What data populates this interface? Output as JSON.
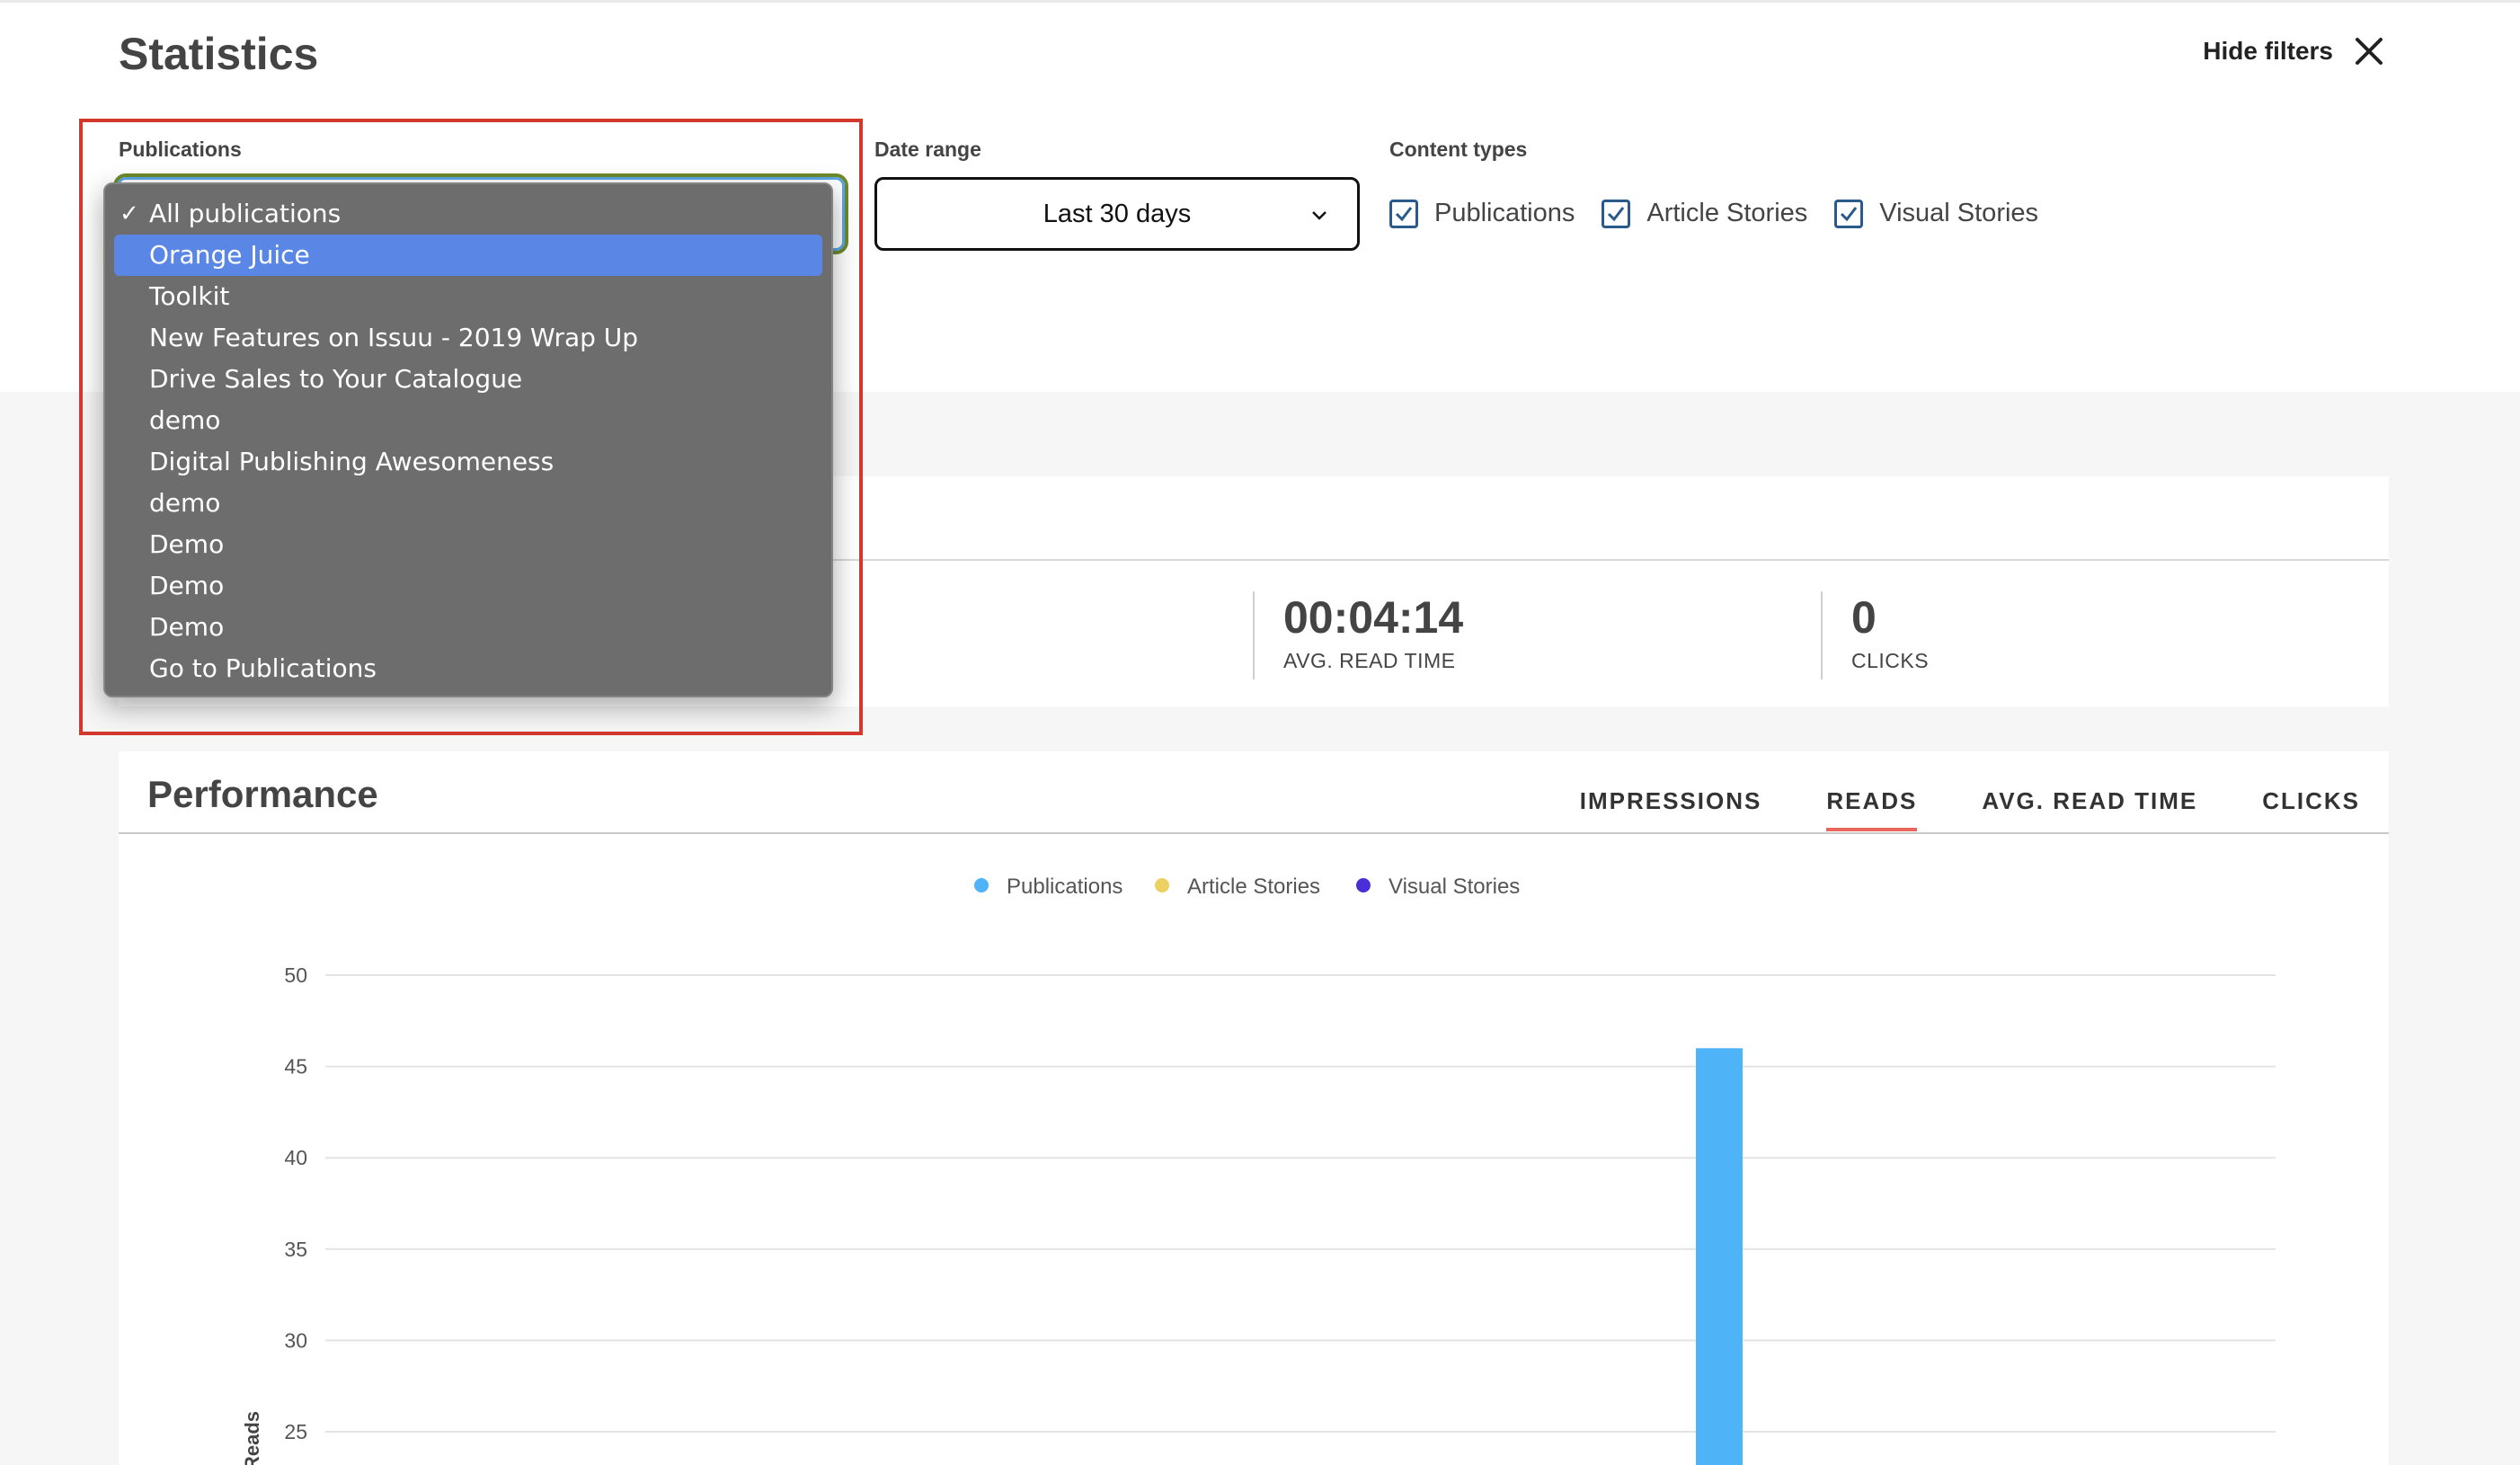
{
  "header": {
    "title": "Statistics",
    "hide_filters_label": "Hide filters"
  },
  "filters": {
    "publications_label": "Publications",
    "date_range_label": "Date range",
    "date_range_value": "Last 30 days",
    "content_types_label": "Content types",
    "content_types": [
      {
        "label": "Publications",
        "checked": true
      },
      {
        "label": "Article Stories",
        "checked": true
      },
      {
        "label": "Visual Stories",
        "checked": true
      }
    ]
  },
  "publications_dropdown": {
    "items": [
      {
        "label": "All publications",
        "checked": true
      },
      {
        "label": "Orange Juice",
        "highlighted": true
      },
      {
        "label": "Toolkit"
      },
      {
        "label": "New Features on Issuu - 2019 Wrap Up"
      },
      {
        "label": "Drive Sales to Your Catalogue"
      },
      {
        "label": "demo"
      },
      {
        "label": "Digital Publishing Awesomeness"
      },
      {
        "label": "demo"
      },
      {
        "label": "Demo"
      },
      {
        "label": "Demo"
      },
      {
        "label": "Demo"
      },
      {
        "label": "Go to Publications"
      }
    ]
  },
  "stats": {
    "avg_read_time_value": "00:04:14",
    "avg_read_time_label": "AVG. READ TIME",
    "clicks_value": "0",
    "clicks_label": "CLICKS"
  },
  "performance": {
    "title": "Performance",
    "tabs": [
      {
        "label": "IMPRESSIONS",
        "active": false
      },
      {
        "label": "READS",
        "active": true
      },
      {
        "label": "AVG. READ TIME",
        "active": false
      },
      {
        "label": "CLICKS",
        "active": false
      }
    ]
  },
  "colors": {
    "publications": "#4fb3f7",
    "article_stories": "#ecd062",
    "visual_stories": "#4a2fd8",
    "active_tab_underline": "#e8675b",
    "highlight_box": "#d2392c",
    "dropdown_highlight": "#5a86e6"
  },
  "chart_data": {
    "type": "bar",
    "ylabel": "Reads",
    "yticks": [
      25,
      30,
      35,
      40,
      45,
      50
    ],
    "ylim": [
      0,
      50
    ],
    "grid": true,
    "legend_position": "top-center",
    "series": [
      {
        "name": "Publications",
        "color": "#4fb3f7",
        "values": [
          46
        ]
      },
      {
        "name": "Article Stories",
        "color": "#ecd062",
        "values": [
          0
        ]
      },
      {
        "name": "Visual Stories",
        "color": "#4a2fd8",
        "values": [
          0
        ]
      }
    ]
  }
}
